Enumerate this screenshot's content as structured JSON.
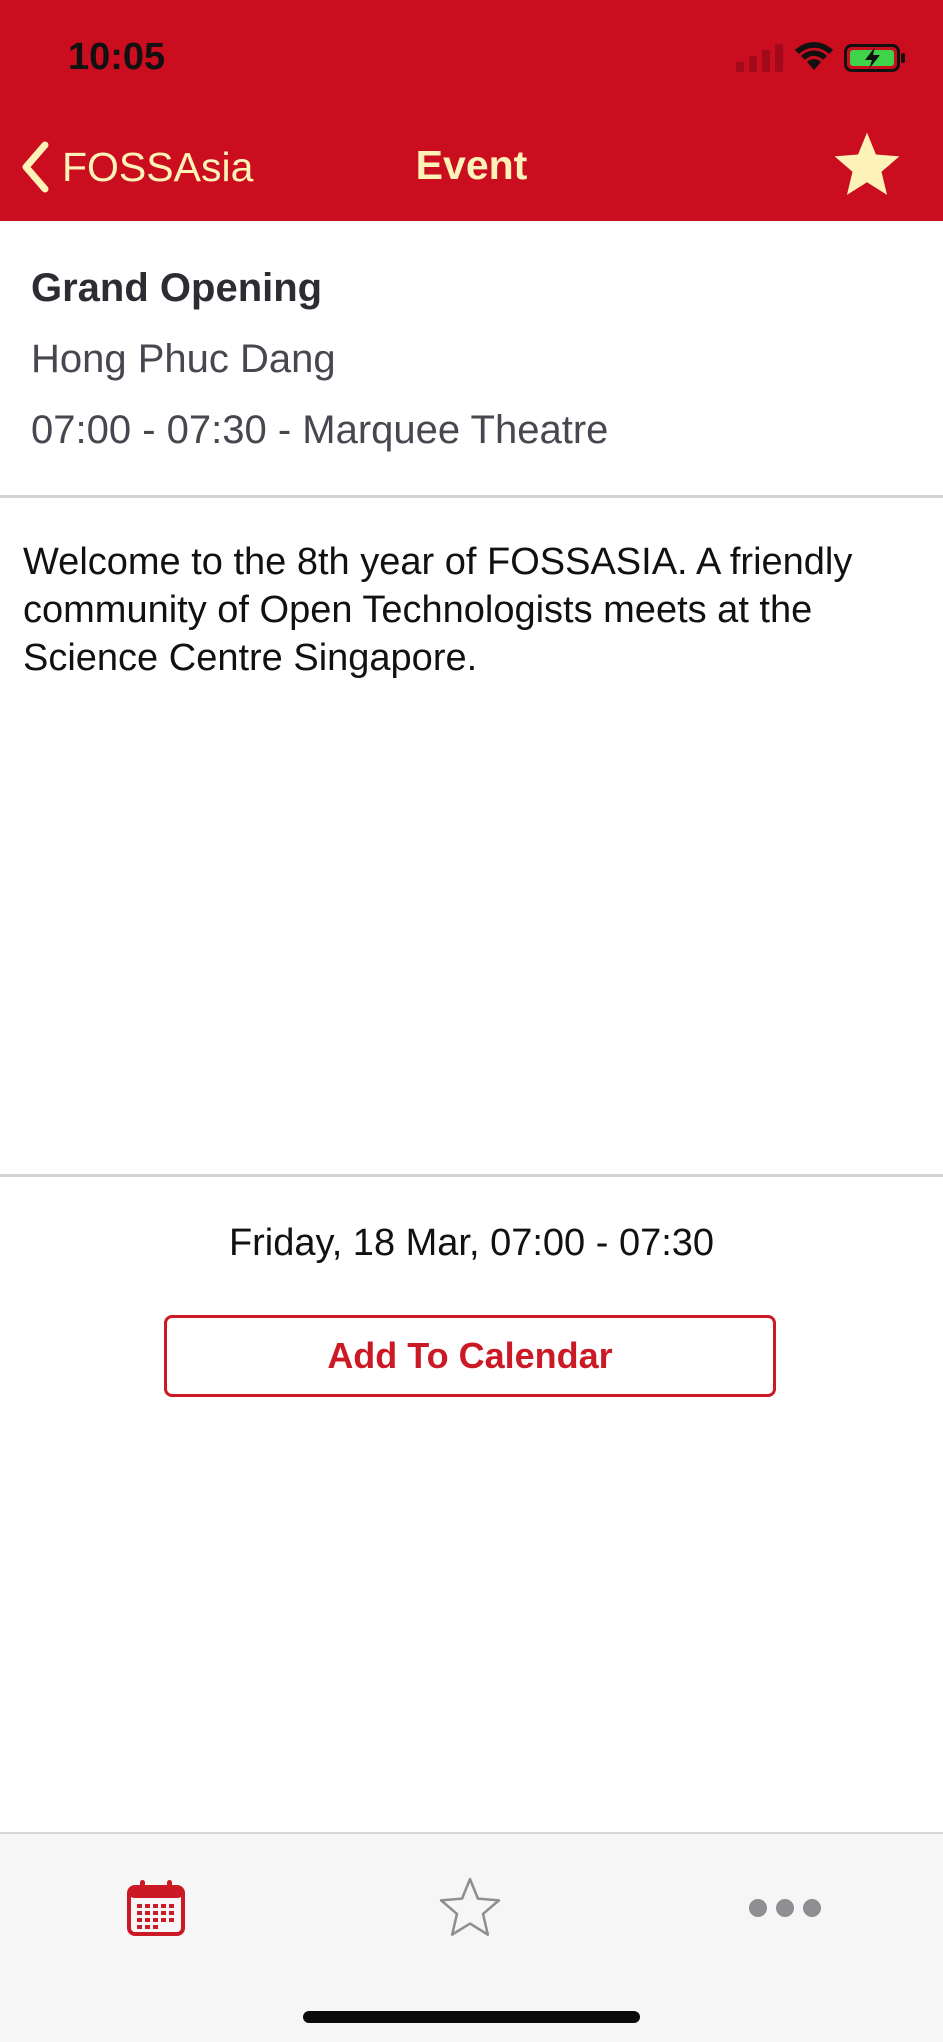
{
  "status_bar": {
    "time": "10:05"
  },
  "nav": {
    "back_label": "FOSSAsia",
    "title": "Event",
    "favorite_icon": "star-filled-icon"
  },
  "event": {
    "title": "Grand Opening",
    "speaker": "Hong Phuc Dang",
    "time_location": "07:00 - 07:30 - Marquee Theatre",
    "description": "Welcome to the 8th year of FOSSASIA. A friendly community of Open Technologists meets at the Science Centre Singapore."
  },
  "calendar": {
    "date_range": "Friday, 18 Mar, 07:00 - 07:30",
    "button_label": "Add To Calendar"
  },
  "tab_bar": {
    "tabs": [
      {
        "icon": "calendar-icon",
        "active": true
      },
      {
        "icon": "star-outline-icon",
        "active": false
      },
      {
        "icon": "more-dots-icon",
        "active": false
      }
    ]
  },
  "colors": {
    "brand_red": "#cb0d20",
    "header_text": "#fdf3b8",
    "button_red": "#cb1a26"
  }
}
